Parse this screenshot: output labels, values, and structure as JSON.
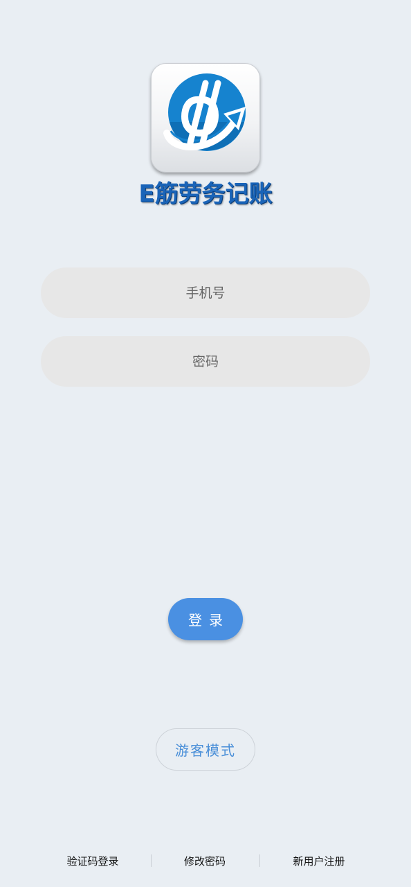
{
  "app": {
    "name": "E筋劳务记账",
    "logo_icon": "currency-growth-logo",
    "brand_blue": "#1a7fcf",
    "accent_blue": "#4a90e2"
  },
  "form": {
    "phone_placeholder": "手机号",
    "password_placeholder": "密码"
  },
  "actions": {
    "login_label": "登录",
    "guest_label": "游客模式"
  },
  "footer": {
    "links": [
      {
        "label": "验证码登录"
      },
      {
        "label": "修改密码"
      },
      {
        "label": "新用户注册"
      }
    ]
  }
}
